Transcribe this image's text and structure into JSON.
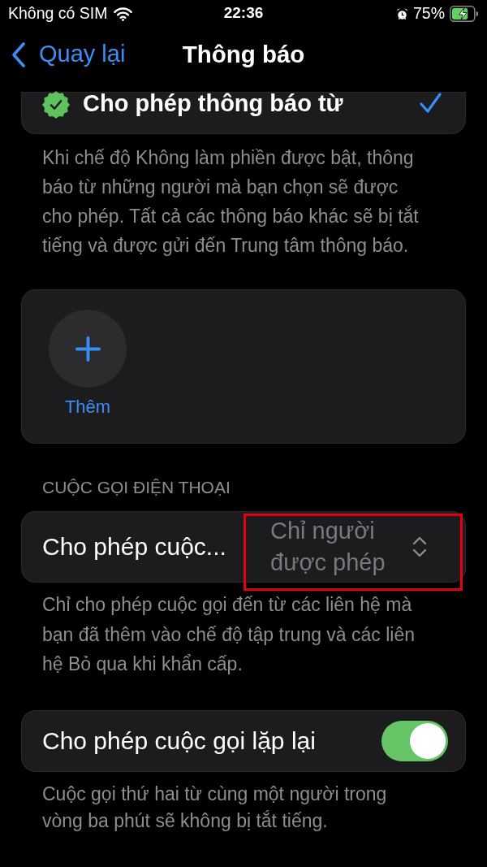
{
  "status_bar": {
    "carrier": "Không có SIM",
    "time": "22:36",
    "alarm": true,
    "battery": "75%",
    "charging": true
  },
  "nav": {
    "back": "Quay lại",
    "title": "Thông báo"
  },
  "sections": [
    {
      "kind": "check",
      "label": "Cho phép thông báo từ",
      "checked": true,
      "footer": "Khi chế độ Không làm phiền được bật, thông báo từ những người mà bạn chọn sẽ được cho phép. Tất cả các thông báo khác sẽ bị tắt tiếng và được gửi đến Trung tâm thông báo."
    },
    {
      "kind": "add",
      "label": "Thêm"
    },
    {
      "kind": "menu",
      "header": "CUỘC GỌI ĐIỆN THOẠI",
      "label": "Cho phép cuộc...",
      "value": "Chỉ người được phép",
      "highlighted": true,
      "footer": "Chỉ cho phép cuộc gọi đến từ các liên hệ mà bạn đã thêm vào chế độ tập trung và các liên hệ Bỏ qua khi khẩn cấp."
    },
    {
      "kind": "toggle",
      "label": "Cho phép cuộc gọi lặp lại",
      "on": true,
      "footer": "Cuộc gọi thứ hai từ cùng một người trong vòng ba phút sẽ không bị tắt tiếng."
    }
  ]
}
